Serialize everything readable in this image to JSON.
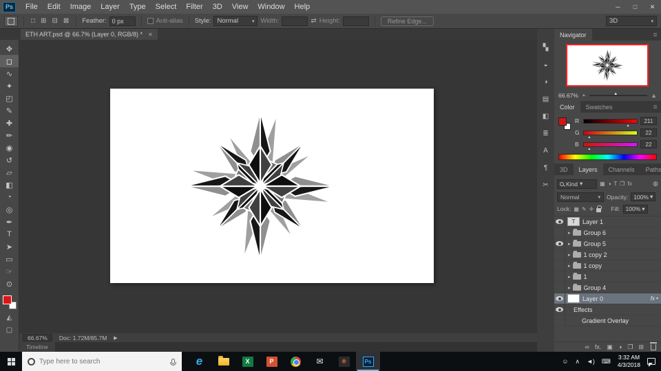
{
  "app": {
    "logo": "Ps"
  },
  "menubar": {
    "items": [
      "File",
      "Edit",
      "Image",
      "Layer",
      "Type",
      "Select",
      "Filter",
      "3D",
      "View",
      "Window",
      "Help"
    ]
  },
  "window_controls": {
    "minimize": "─",
    "maximize": "□",
    "close": "✕"
  },
  "glyphs": {
    "chevron_down": "▾",
    "panel_menu": "≣",
    "arrow_right": "▸",
    "play": "▶",
    "triangle_up": "▲",
    "mountain": "▲",
    "swap": "⇄"
  },
  "options": {
    "selection_modes": [
      {
        "name": "new-selection",
        "glyph": "□"
      },
      {
        "name": "add-selection",
        "glyph": "⊞"
      },
      {
        "name": "subtract-selection",
        "glyph": "⊟"
      },
      {
        "name": "intersect-selection",
        "glyph": "⊠"
      }
    ],
    "feather_label": "Feather:",
    "feather_value": "0 px",
    "antialias_label": "Anti-alias",
    "style_label": "Style:",
    "style_value": "Normal",
    "width_label": "Width:",
    "height_label": "Height:",
    "refine_edge_label": "Refine Edge...",
    "workspace": "3D"
  },
  "doc_tab": {
    "title": "ETH ART.psd @ 66.7% (Layer 0, RGB/8) *",
    "close": "✕"
  },
  "tools": [
    {
      "name": "move-tool",
      "glyph": "✥"
    },
    {
      "name": "marquee-tool",
      "glyph": "◻"
    },
    {
      "name": "lasso-tool",
      "glyph": "∿"
    },
    {
      "name": "quick-selection-tool",
      "glyph": "✦"
    },
    {
      "name": "crop-tool",
      "glyph": "◰"
    },
    {
      "name": "eyedropper-tool",
      "glyph": "✎"
    },
    {
      "name": "healing-brush-tool",
      "glyph": "✚"
    },
    {
      "name": "brush-tool",
      "glyph": "✏"
    },
    {
      "name": "clone-stamp-tool",
      "glyph": "◉"
    },
    {
      "name": "history-brush-tool",
      "glyph": "↺"
    },
    {
      "name": "eraser-tool",
      "glyph": "▱"
    },
    {
      "name": "gradient-tool",
      "glyph": "◧"
    },
    {
      "name": "blur-tool",
      "glyph": "◔"
    },
    {
      "name": "dodge-tool",
      "glyph": "◎"
    },
    {
      "name": "pen-tool",
      "glyph": "✒"
    },
    {
      "name": "type-tool",
      "glyph": "T"
    },
    {
      "name": "path-selection-tool",
      "glyph": "➤"
    },
    {
      "name": "shape-tool",
      "glyph": "▭"
    },
    {
      "name": "hand-tool",
      "glyph": "☞"
    },
    {
      "name": "zoom-tool",
      "glyph": "⊙"
    }
  ],
  "toolbar_extras": [
    {
      "name": "quick-mask-mode",
      "glyph": "◭"
    },
    {
      "name": "screen-mode",
      "glyph": "▢"
    }
  ],
  "panel_strip": [
    {
      "name": "history-panel",
      "glyph": "▚"
    },
    {
      "name": "info-panel",
      "glyph": "◒"
    },
    {
      "name": "adjustments-panel",
      "glyph": "◑"
    },
    {
      "name": "styles-panel",
      "glyph": "▤"
    },
    {
      "name": "properties-panel",
      "glyph": "◧"
    },
    {
      "name": "brush-settings-panel",
      "glyph": "≣"
    },
    {
      "name": "character-panel",
      "glyph": "A"
    },
    {
      "name": "paragraph-panel",
      "glyph": "¶"
    },
    {
      "name": "scissors-panel",
      "glyph": "✂"
    }
  ],
  "navigator": {
    "tab": "Navigator",
    "zoom": "66.67%"
  },
  "color_panel": {
    "tabs": [
      "Color",
      "Swatches"
    ],
    "channels": [
      {
        "label": "R",
        "value": "211"
      },
      {
        "label": "G",
        "value": "22"
      },
      {
        "label": "B",
        "value": "22"
      }
    ]
  },
  "panel_tabs": [
    "3D",
    "Layers",
    "Channels",
    "Paths"
  ],
  "layers_panel": {
    "kind_label": "Kind",
    "filter_icons": [
      {
        "name": "filter-pixel-layers-icon",
        "glyph": "▦"
      },
      {
        "name": "filter-adjustment-layers-icon",
        "glyph": "◑"
      },
      {
        "name": "filter-type-layers-icon",
        "glyph": "T"
      },
      {
        "name": "filter-group-layers-icon",
        "glyph": "❐"
      },
      {
        "name": "filter-effect-layers-icon",
        "glyph": "fx"
      }
    ],
    "filter_toggle_glyph": "◍",
    "blend_mode": "Normal",
    "opacity_label": "Opacity:",
    "opacity_value": "100%",
    "lock_label": "Lock:",
    "lock_icons": [
      {
        "name": "lock-transparency-icon",
        "glyph": "▦"
      },
      {
        "name": "lock-image-icon",
        "glyph": "✎"
      },
      {
        "name": "lock-position-icon",
        "glyph": "✛"
      }
    ],
    "fill_label": "Fill:",
    "fill_value": "100%",
    "layers": [
      {
        "name": "Layer 1",
        "eye": true,
        "thumb": "T"
      },
      {
        "name": "Group 6",
        "eye": false
      },
      {
        "name": "Group 5",
        "eye": true
      },
      {
        "name": "1 copy 2",
        "eye": false
      },
      {
        "name": "1 copy",
        "eye": false
      },
      {
        "name": "1",
        "eye": false
      },
      {
        "name": "Group 4",
        "eye": false
      },
      {
        "name": "Layer 0",
        "eye": true,
        "selected": true,
        "badge": "fx"
      },
      {
        "name": "Effects",
        "eye": true
      },
      {
        "name": "Gradient Overlay",
        "eye": false
      }
    ],
    "footer_icons": [
      {
        "name": "link-layers-icon",
        "glyph": "∞"
      },
      {
        "name": "layer-style-icon",
        "glyph": "fx."
      },
      {
        "name": "layer-mask-icon",
        "glyph": "▣"
      },
      {
        "name": "adjustment-layer-icon",
        "glyph": "◑"
      },
      {
        "name": "new-group-icon",
        "glyph": "❐"
      },
      {
        "name": "new-layer-icon",
        "glyph": "⊞"
      }
    ]
  },
  "status_bar": {
    "zoom": "66.67%",
    "doc": "Doc: 1.72M/85.7M"
  },
  "timeline": {
    "label": "Timeline"
  },
  "taskbar": {
    "search_placeholder": "Type here to search",
    "apps": [
      {
        "name": "edge",
        "glyph": "e"
      },
      {
        "name": "file-explorer",
        "glyph": ""
      },
      {
        "name": "excel",
        "glyph": "X"
      },
      {
        "name": "powerpoint",
        "glyph": "P"
      },
      {
        "name": "chrome",
        "glyph": ""
      },
      {
        "name": "mail",
        "glyph": "✉"
      },
      {
        "name": "photos",
        "glyph": "❋"
      },
      {
        "name": "photoshop",
        "glyph": "Ps",
        "active": true
      }
    ],
    "tray": [
      {
        "name": "user-icon",
        "glyph": "☺"
      },
      {
        "name": "hidden-icons-chevron",
        "glyph": "∧"
      },
      {
        "name": "volume-icon",
        "glyph": "◄)"
      },
      {
        "name": "keyboard-icon",
        "glyph": "⌨"
      }
    ],
    "time": "3:32 AM",
    "date": "4/3/2018"
  }
}
